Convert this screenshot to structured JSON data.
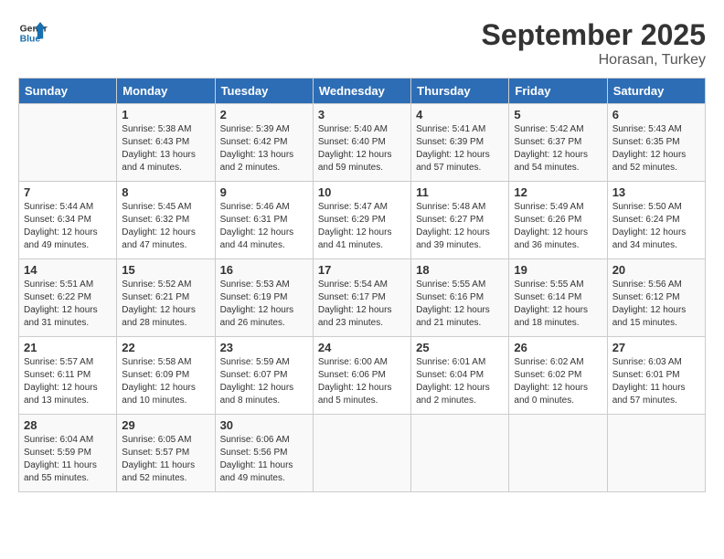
{
  "header": {
    "logo_line1": "General",
    "logo_line2": "Blue",
    "month_title": "September 2025",
    "subtitle": "Horasan, Turkey"
  },
  "columns": [
    "Sunday",
    "Monday",
    "Tuesday",
    "Wednesday",
    "Thursday",
    "Friday",
    "Saturday"
  ],
  "weeks": [
    [
      {
        "day": "",
        "info": ""
      },
      {
        "day": "1",
        "info": "Sunrise: 5:38 AM\nSunset: 6:43 PM\nDaylight: 13 hours\nand 4 minutes."
      },
      {
        "day": "2",
        "info": "Sunrise: 5:39 AM\nSunset: 6:42 PM\nDaylight: 13 hours\nand 2 minutes."
      },
      {
        "day": "3",
        "info": "Sunrise: 5:40 AM\nSunset: 6:40 PM\nDaylight: 12 hours\nand 59 minutes."
      },
      {
        "day": "4",
        "info": "Sunrise: 5:41 AM\nSunset: 6:39 PM\nDaylight: 12 hours\nand 57 minutes."
      },
      {
        "day": "5",
        "info": "Sunrise: 5:42 AM\nSunset: 6:37 PM\nDaylight: 12 hours\nand 54 minutes."
      },
      {
        "day": "6",
        "info": "Sunrise: 5:43 AM\nSunset: 6:35 PM\nDaylight: 12 hours\nand 52 minutes."
      }
    ],
    [
      {
        "day": "7",
        "info": "Sunrise: 5:44 AM\nSunset: 6:34 PM\nDaylight: 12 hours\nand 49 minutes."
      },
      {
        "day": "8",
        "info": "Sunrise: 5:45 AM\nSunset: 6:32 PM\nDaylight: 12 hours\nand 47 minutes."
      },
      {
        "day": "9",
        "info": "Sunrise: 5:46 AM\nSunset: 6:31 PM\nDaylight: 12 hours\nand 44 minutes."
      },
      {
        "day": "10",
        "info": "Sunrise: 5:47 AM\nSunset: 6:29 PM\nDaylight: 12 hours\nand 41 minutes."
      },
      {
        "day": "11",
        "info": "Sunrise: 5:48 AM\nSunset: 6:27 PM\nDaylight: 12 hours\nand 39 minutes."
      },
      {
        "day": "12",
        "info": "Sunrise: 5:49 AM\nSunset: 6:26 PM\nDaylight: 12 hours\nand 36 minutes."
      },
      {
        "day": "13",
        "info": "Sunrise: 5:50 AM\nSunset: 6:24 PM\nDaylight: 12 hours\nand 34 minutes."
      }
    ],
    [
      {
        "day": "14",
        "info": "Sunrise: 5:51 AM\nSunset: 6:22 PM\nDaylight: 12 hours\nand 31 minutes."
      },
      {
        "day": "15",
        "info": "Sunrise: 5:52 AM\nSunset: 6:21 PM\nDaylight: 12 hours\nand 28 minutes."
      },
      {
        "day": "16",
        "info": "Sunrise: 5:53 AM\nSunset: 6:19 PM\nDaylight: 12 hours\nand 26 minutes."
      },
      {
        "day": "17",
        "info": "Sunrise: 5:54 AM\nSunset: 6:17 PM\nDaylight: 12 hours\nand 23 minutes."
      },
      {
        "day": "18",
        "info": "Sunrise: 5:55 AM\nSunset: 6:16 PM\nDaylight: 12 hours\nand 21 minutes."
      },
      {
        "day": "19",
        "info": "Sunrise: 5:55 AM\nSunset: 6:14 PM\nDaylight: 12 hours\nand 18 minutes."
      },
      {
        "day": "20",
        "info": "Sunrise: 5:56 AM\nSunset: 6:12 PM\nDaylight: 12 hours\nand 15 minutes."
      }
    ],
    [
      {
        "day": "21",
        "info": "Sunrise: 5:57 AM\nSunset: 6:11 PM\nDaylight: 12 hours\nand 13 minutes."
      },
      {
        "day": "22",
        "info": "Sunrise: 5:58 AM\nSunset: 6:09 PM\nDaylight: 12 hours\nand 10 minutes."
      },
      {
        "day": "23",
        "info": "Sunrise: 5:59 AM\nSunset: 6:07 PM\nDaylight: 12 hours\nand 8 minutes."
      },
      {
        "day": "24",
        "info": "Sunrise: 6:00 AM\nSunset: 6:06 PM\nDaylight: 12 hours\nand 5 minutes."
      },
      {
        "day": "25",
        "info": "Sunrise: 6:01 AM\nSunset: 6:04 PM\nDaylight: 12 hours\nand 2 minutes."
      },
      {
        "day": "26",
        "info": "Sunrise: 6:02 AM\nSunset: 6:02 PM\nDaylight: 12 hours\nand 0 minutes."
      },
      {
        "day": "27",
        "info": "Sunrise: 6:03 AM\nSunset: 6:01 PM\nDaylight: 11 hours\nand 57 minutes."
      }
    ],
    [
      {
        "day": "28",
        "info": "Sunrise: 6:04 AM\nSunset: 5:59 PM\nDaylight: 11 hours\nand 55 minutes."
      },
      {
        "day": "29",
        "info": "Sunrise: 6:05 AM\nSunset: 5:57 PM\nDaylight: 11 hours\nand 52 minutes."
      },
      {
        "day": "30",
        "info": "Sunrise: 6:06 AM\nSunset: 5:56 PM\nDaylight: 11 hours\nand 49 minutes."
      },
      {
        "day": "",
        "info": ""
      },
      {
        "day": "",
        "info": ""
      },
      {
        "day": "",
        "info": ""
      },
      {
        "day": "",
        "info": ""
      }
    ]
  ]
}
